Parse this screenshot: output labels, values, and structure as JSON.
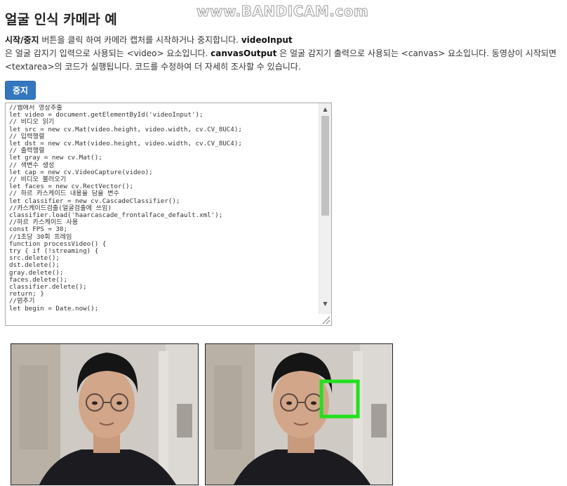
{
  "watermark": "www.BANDICAM.com",
  "title": "얼굴 인식 카메라 예",
  "description": {
    "bold1": "시작/중지",
    "text1": " 버튼을 클릭 하여 카메라 캡처를 시작하거나 중지합니다. ",
    "bold2": "videoInput",
    "text2": "은 얼굴 감지기 입력으로 사용되는 <video> 요소입니다. ",
    "bold3": "canvasOutput",
    "text3": " 은 얼굴 감지기 출력으로 사용되는 <canvas> 요소입니다. 동영상이 시작되면 <textarea>의 코드가 실행됩니다. 코드를 수정하여 더 자세히 조사할 수 있습니다."
  },
  "button": {
    "label": "중지"
  },
  "code_lines": [
    "//웹에서 영상추출",
    "let video = document.getElementById('videoInput');",
    "// 비디오 읽기",
    "let src = new cv.Mat(video.height, video.width, cv.CV_8UC4);",
    "// 입력행렬",
    "let dst = new cv.Mat(video.height, video.width, cv.CV_8UC4);",
    "// 출력행렬",
    "let gray = new cv.Mat();",
    "// 색변수 생성",
    "let cap = new cv.VideoCapture(video);",
    "// 비디오 불러오기",
    "let faces = new cv.RectVector();",
    "// 하르 카스케이드 내용을 담을 변수",
    "let classifier = new cv.CascadeClassifier();",
    "//카스케이드검출(얼굴검출에 쓰임)",
    "classifier.load('haarcascade_frontalface_default.xml');",
    "//하르 카스케이드 사용",
    "const FPS = 30;",
    "//1초당 30회 프레임",
    "function processVideo() {",
    "try { if (!streaming) {",
    "src.delete();",
    "dst.delete();",
    "gray.delete();",
    "faces.delete();",
    "classifier.delete();",
    "return; }",
    "//멈추기",
    "let begin = Date.now();"
  ],
  "icons": {
    "scroll_up": "▲",
    "scroll_down": "▼"
  },
  "colors": {
    "button": "#3277c0",
    "detection_box": "#22e01e"
  }
}
